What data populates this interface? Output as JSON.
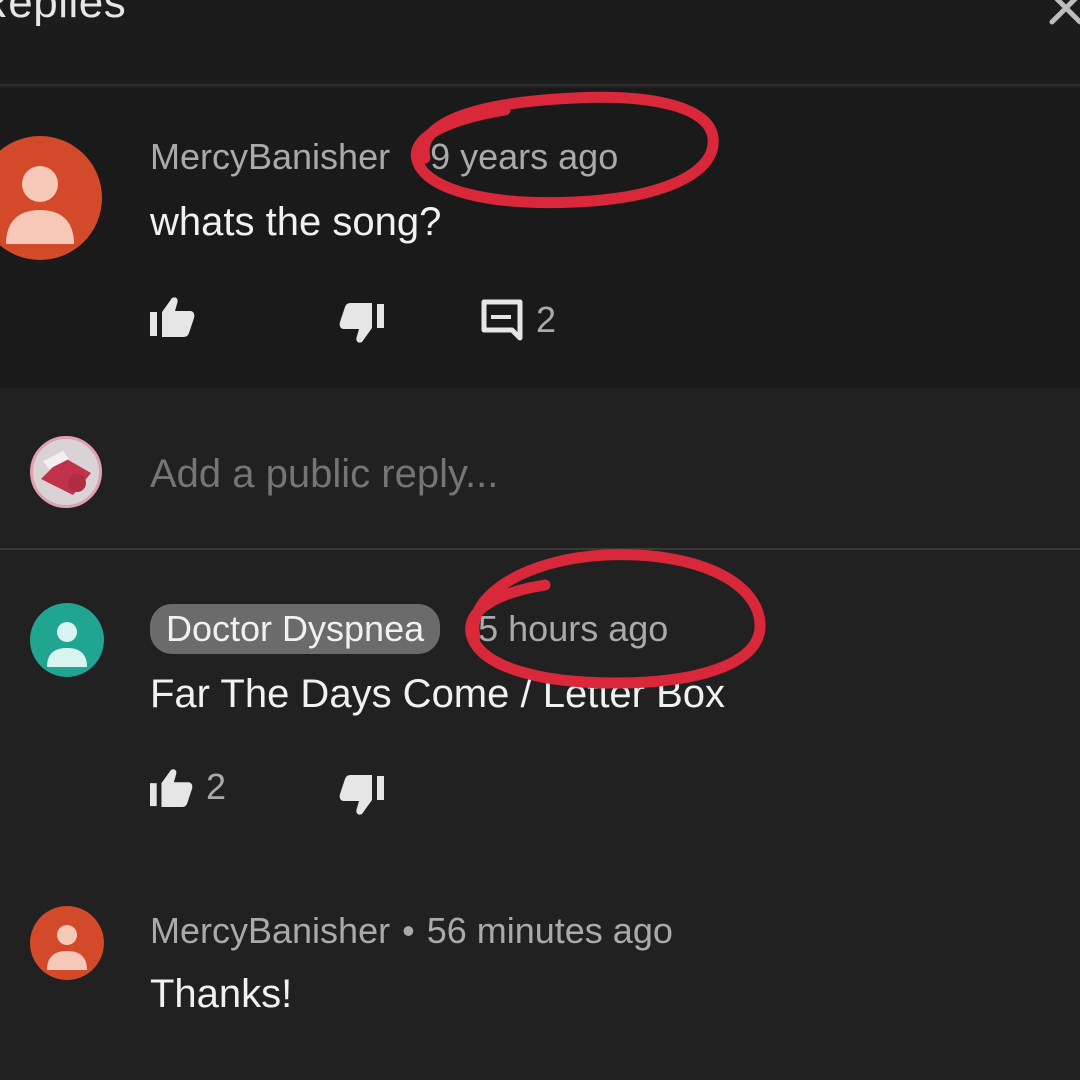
{
  "header": {
    "title": "Replies"
  },
  "parent": {
    "author": "MercyBanisher",
    "time": "9 years ago",
    "text": "whats the song?",
    "reply_count": "2"
  },
  "reply_input": {
    "placeholder": "Add a public reply..."
  },
  "replies": [
    {
      "author": "Doctor Dyspnea",
      "time": "5 hours ago",
      "text": "Far The Days Come / Letter Box",
      "like_count": "2"
    },
    {
      "author": "MercyBanisher",
      "separator": "•",
      "time": "56 minutes ago",
      "text": "Thanks!"
    }
  ],
  "colors": {
    "background": "#212121",
    "avatar_red": "#d24a2a",
    "avatar_teal": "#1fa592",
    "annotation_red": "#d9283a"
  },
  "icons": [
    "close-icon",
    "like-icon",
    "dislike-icon",
    "reply-icon",
    "avatar-person-icon"
  ]
}
